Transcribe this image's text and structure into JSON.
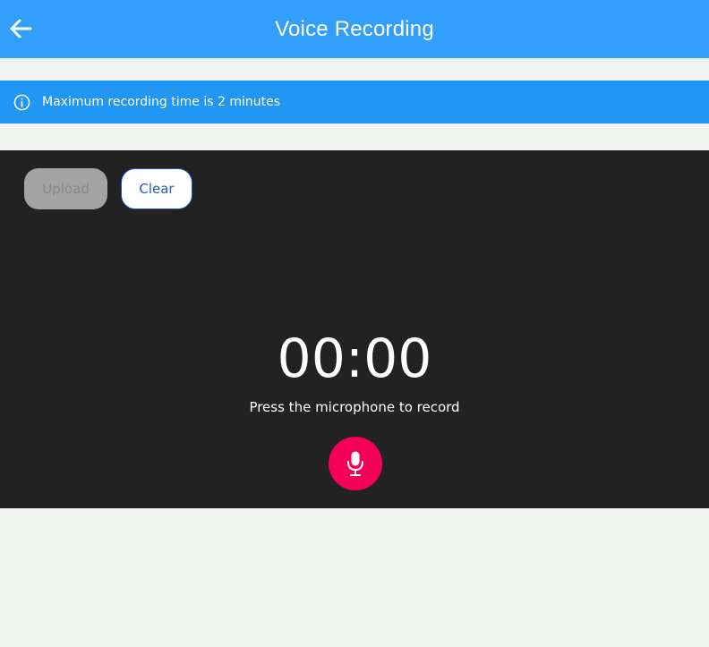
{
  "app_bar": {
    "title": "Voice Recording",
    "back_icon": "arrow-left-icon",
    "color": "#339ffd"
  },
  "info_banner": {
    "icon": "info-circle-icon",
    "text": "Maximum recording time is 2 minutes",
    "color": "#2196f3"
  },
  "recorder": {
    "upload_label": "Upload",
    "upload_disabled": true,
    "clear_label": "Clear",
    "timer": "00:00",
    "hint": "Press the microphone to record",
    "mic_icon": "microphone-icon",
    "mic_color": "#f50057",
    "background": "#222222"
  }
}
